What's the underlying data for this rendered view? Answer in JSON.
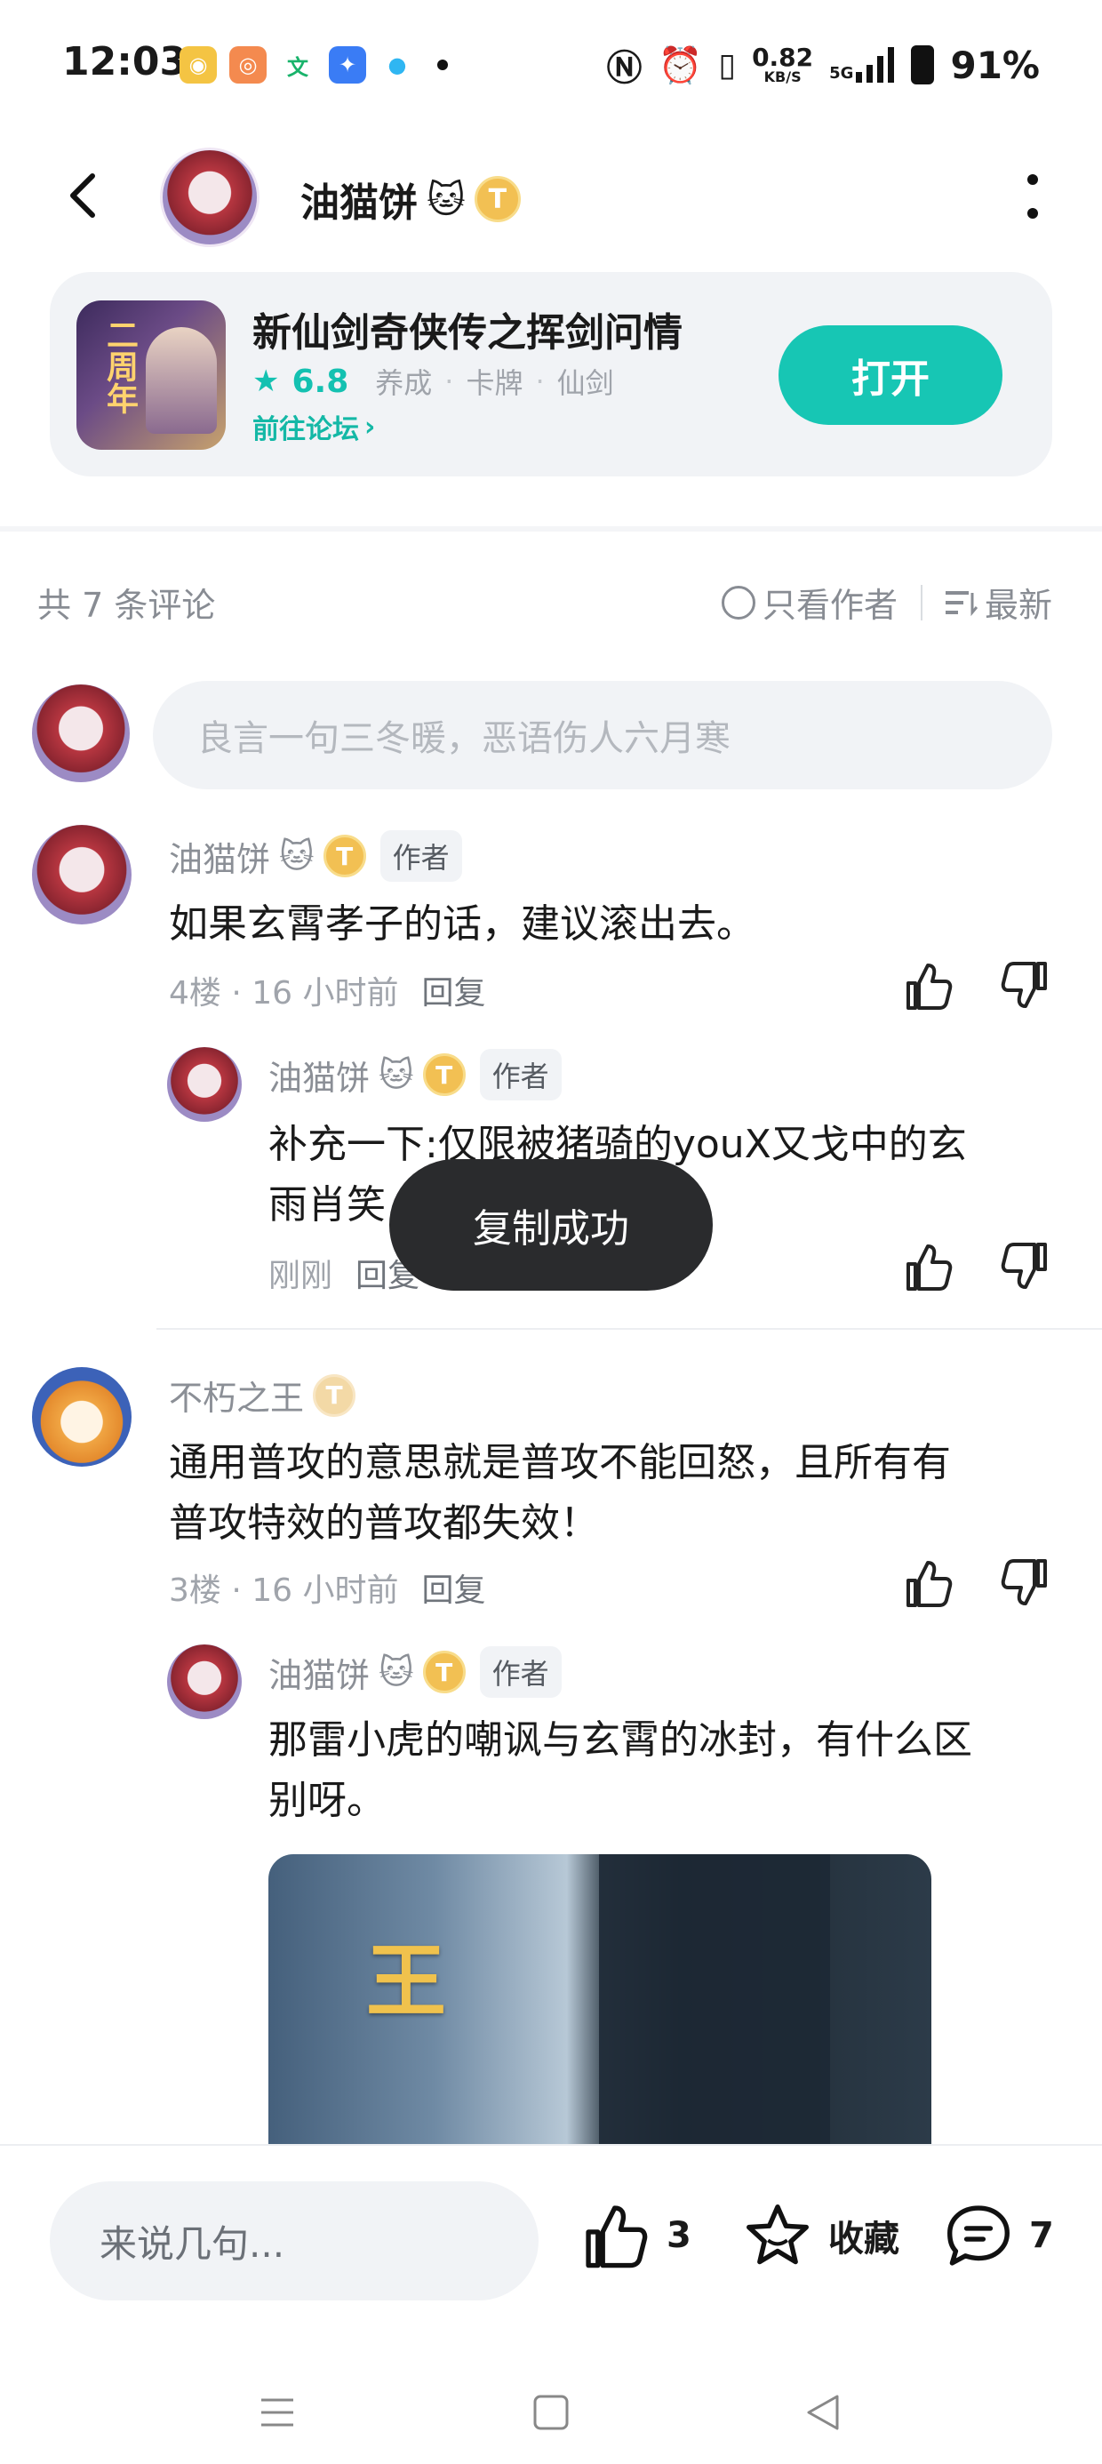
{
  "status_bar": {
    "time": "12:03",
    "apps": [
      {
        "icon": "weibo-icon",
        "color": "#f4c443",
        "glyph": "◉"
      },
      {
        "icon": "orange-app-icon",
        "color": "#f48a4f",
        "glyph": "◎"
      },
      {
        "icon": "wen-app-icon",
        "color": "#ffffff",
        "glyph": "文"
      },
      {
        "icon": "blue-app-icon",
        "color": "#3a7cf5",
        "glyph": "✦"
      },
      {
        "icon": "qq-icon",
        "color": "#2fb6f2",
        "glyph": "●"
      }
    ],
    "net_speed": "0.82",
    "net_unit": "KB/S",
    "signal_label": "5G",
    "battery": "91%"
  },
  "header": {
    "username": "油猫饼",
    "emoji": "🐱",
    "badge": "T"
  },
  "game": {
    "title": "新仙剑奇侠传之挥剑问情",
    "score": "6.8",
    "tags": [
      "养成",
      "卡牌",
      "仙剑"
    ],
    "forum_link": "前往论坛",
    "open_button": "打开",
    "icon_text": "二周年"
  },
  "comments_header": {
    "count_text": "共 7 条评论",
    "author_only": "只看作者",
    "sort": "最新"
  },
  "composer": {
    "placeholder": "良言一句三冬暖，恶语伤人六月寒"
  },
  "comments": [
    {
      "name": "油猫饼",
      "emoji": "🐱",
      "author_tag": "作者",
      "text": "如果玄霄孝子的话，建议滚出去。",
      "floor": "4楼 · 16 小时前",
      "reply": "回复",
      "replies": [
        {
          "name": "油猫饼",
          "emoji": "🐱",
          "author_tag": "作者",
          "text_line1": "补充一下:仅限被猪骑的youX又戈中的玄",
          "text_line2": "雨肖笑",
          "time": "刚刚",
          "reply": "回复"
        }
      ]
    },
    {
      "name": "不朽之王",
      "text_line1": "通用普攻的意思就是普攻不能回怒，且所有有",
      "text_line2": "普攻特效的普攻都失效！",
      "floor": "3楼 · 16 小时前",
      "reply": "回复",
      "replies": [
        {
          "name": "油猫饼",
          "emoji": "🐱",
          "author_tag": "作者",
          "text_line1": "那雷小虎的嘲讽与玄霄的冰封，有什么区",
          "text_line2": "别呀。",
          "image_text": "王"
        }
      ]
    }
  ],
  "toast": "复制成功",
  "bottom_bar": {
    "input_placeholder": "来说几句...",
    "likes": "3",
    "favorite": "收藏",
    "comments": "7"
  },
  "colors": {
    "accent": "#17c6b4",
    "badge_gold": "#f2c053"
  }
}
